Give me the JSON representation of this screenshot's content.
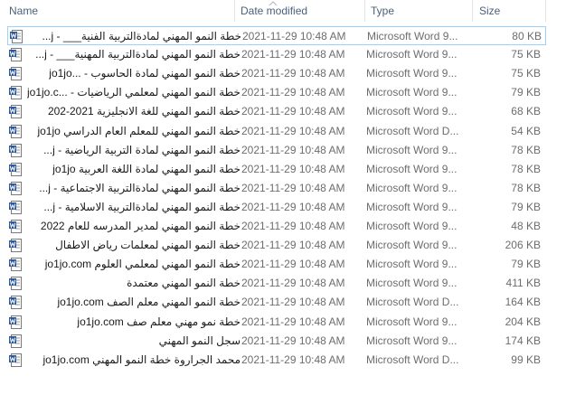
{
  "columns": {
    "name": "Name",
    "date": "Date modified",
    "type": "Type",
    "size": "Size"
  },
  "files": [
    {
      "name": "خطة النمو المهني لمادةالتربية الفنية___ - j...",
      "date": "2021-11-29 10:48 AM",
      "type": "Microsoft Word 9...",
      "size": "80 KB"
    },
    {
      "name": "خطة النمو المهني لمادةالتربية المهنية___ - j...",
      "date": "2021-11-29 10:48 AM",
      "type": "Microsoft Word 9...",
      "size": "75 KB"
    },
    {
      "name": "jo1jo... - خطة النمو المهني لمادة الحاسوب",
      "date": "2021-11-29 10:48 AM",
      "type": "Microsoft Word 9...",
      "size": "75 KB"
    },
    {
      "name": "jo1jo.c... - خطة النمو المهني لمعلمي الرياضيات__",
      "date": "2021-11-29 10:48 AM",
      "type": "Microsoft Word 9...",
      "size": "79 KB"
    },
    {
      "name": "خطة النمو المهني للغة الانجليزية 2021-202",
      "date": "2021-11-29 10:48 AM",
      "type": "Microsoft Word 9...",
      "size": "68 KB"
    },
    {
      "name": "jo1jo خطة النمو المهني للمعلم العام الدراسي",
      "date": "2021-11-29 10:48 AM",
      "type": "Microsoft Word D...",
      "size": "54 KB"
    },
    {
      "name": "خطة النمو المهني لمادة التربية الرياضية - j...",
      "date": "2021-11-29 10:48 AM",
      "type": "Microsoft Word 9...",
      "size": "78 KB"
    },
    {
      "name": "jo1jo خطة النمو المهني لمادة اللغة العربية",
      "date": "2021-11-29 10:48 AM",
      "type": "Microsoft Word 9...",
      "size": "78 KB"
    },
    {
      "name": "خطة النمو المهني لمادةالتربية الاجتماعية - j...",
      "date": "2021-11-29 10:48 AM",
      "type": "Microsoft Word 9...",
      "size": "78 KB"
    },
    {
      "name": "خطة النمو المهني لمادةالتربية الاسلامية - j...",
      "date": "2021-11-29 10:48 AM",
      "type": "Microsoft Word 9...",
      "size": "79 KB"
    },
    {
      "name": "خطة النمو المهني لمدير المدرسه للعام 2022",
      "date": "2021-11-29 10:48 AM",
      "type": "Microsoft Word 9...",
      "size": "48 KB"
    },
    {
      "name": "خطة النمو المهني لمعلمات رياض الاطفال",
      "date": "2021-11-29 10:48 AM",
      "type": "Microsoft Word 9...",
      "size": "206 KB"
    },
    {
      "name": "jo1jo.com خطة النمو المهني لمعلمي العلوم",
      "date": "2021-11-29 10:48 AM",
      "type": "Microsoft Word 9...",
      "size": "79 KB"
    },
    {
      "name": "خطة النمو المهني معتمدة",
      "date": "2021-11-29 10:48 AM",
      "type": "Microsoft Word 9...",
      "size": "411 KB"
    },
    {
      "name": "jo1jo.com خطة النمو المهني معلم الصف",
      "date": "2021-11-29 10:48 AM",
      "type": "Microsoft Word D...",
      "size": "164 KB"
    },
    {
      "name": "jo1jo.com خطة نمو مهني معلم صف",
      "date": "2021-11-29 10:48 AM",
      "type": "Microsoft Word 9...",
      "size": "204 KB"
    },
    {
      "name": "سجل النمو المهني",
      "date": "2021-11-29 10:48 AM",
      "type": "Microsoft Word 9...",
      "size": "174 KB"
    },
    {
      "name": "jo1jo.com محمد الجراروة خطة النمو المهني",
      "date": "2021-11-29 10:48 AM",
      "type": "Microsoft Word D...",
      "size": "99 KB"
    }
  ],
  "colors": {
    "header_text": "#4c607a",
    "meta_text": "#6d6d6d",
    "selection_border": "#99d1ff",
    "word_icon": "#2b579a"
  },
  "icons": {
    "file": "word-document-icon",
    "sort": "chevron-up-icon"
  }
}
